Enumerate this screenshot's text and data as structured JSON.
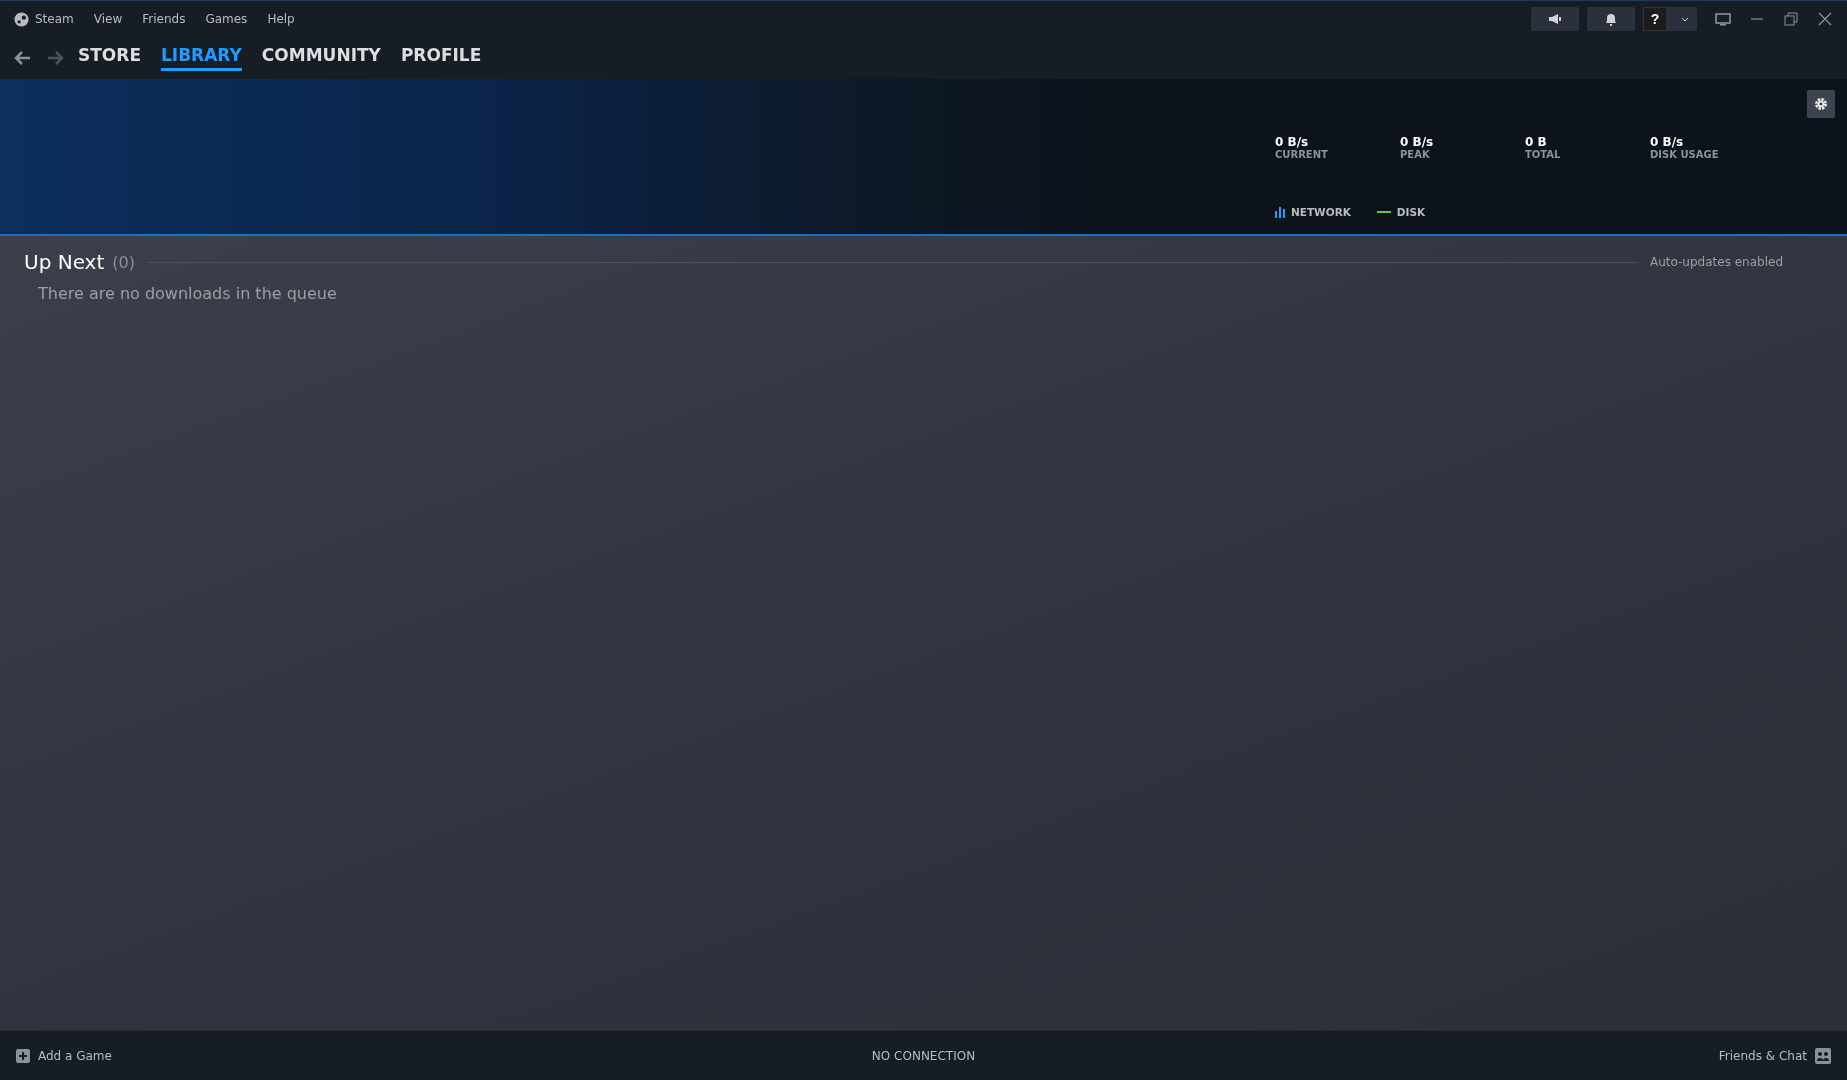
{
  "menu": [
    "Steam",
    "View",
    "Friends",
    "Games",
    "Help"
  ],
  "nav_tabs": [
    {
      "label": "STORE",
      "selected": false
    },
    {
      "label": "LIBRARY",
      "selected": true
    },
    {
      "label": "COMMUNITY",
      "selected": false
    },
    {
      "label": "PROFILE",
      "selected": false
    }
  ],
  "help_button": "?",
  "stats": [
    {
      "value": "0 B/s",
      "label": "CURRENT"
    },
    {
      "value": "0 B/s",
      "label": "PEAK"
    },
    {
      "value": "0 B",
      "label": "TOTAL"
    },
    {
      "value": "0 B/s",
      "label": "DISK USAGE"
    }
  ],
  "legend": [
    {
      "kind": "bars",
      "label": "NETWORK",
      "color": "#1a9fff"
    },
    {
      "kind": "line",
      "label": "DISK",
      "color": "#5ccc3a"
    }
  ],
  "up_next": {
    "title": "Up Next",
    "count": "(0)",
    "status": "Auto-updates enabled",
    "empty_text": "There are no downloads in the queue"
  },
  "footer": {
    "add_game": "Add a Game",
    "connection": "NO CONNECTION",
    "friends": "Friends & Chat"
  }
}
